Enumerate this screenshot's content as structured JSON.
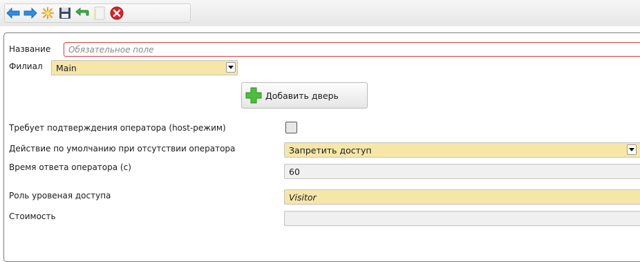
{
  "toolbar": {
    "buttons": [
      {
        "name": "back-button",
        "icon": "arrow-left-icon"
      },
      {
        "name": "forward-button",
        "icon": "arrow-right-icon"
      },
      {
        "name": "new-button",
        "icon": "sparkle-icon"
      },
      {
        "name": "save-button",
        "icon": "floppy-disk-icon"
      },
      {
        "name": "undo-button",
        "icon": "return-arrow-icon"
      },
      {
        "name": "copy-button",
        "icon": "document-icon"
      },
      {
        "name": "close-button",
        "icon": "close-icon"
      }
    ]
  },
  "form": {
    "name_label": "Название",
    "name_placeholder": "Обязательное поле",
    "branch_label": "Филиал",
    "branch_value": "Main",
    "add_door_label": "Добавить дверь",
    "host_mode_label": "Требует подтверждения оператора (host-режим)",
    "default_action_label": "Действие по умолчанию при отсутствии оператора",
    "default_action_value": "Запретить доступ",
    "response_time_label": "Время ответа оператора (с)",
    "response_time_value": "60",
    "access_role_label": "Роль уровеная доступа",
    "access_role_value": "Visitor",
    "cost_label": "Стоимость",
    "cost_value": ""
  },
  "colors": {
    "accent_yellow": "#f6e6a8",
    "required_border": "#e03a3a",
    "arrow_blue": "#2f8de0"
  }
}
